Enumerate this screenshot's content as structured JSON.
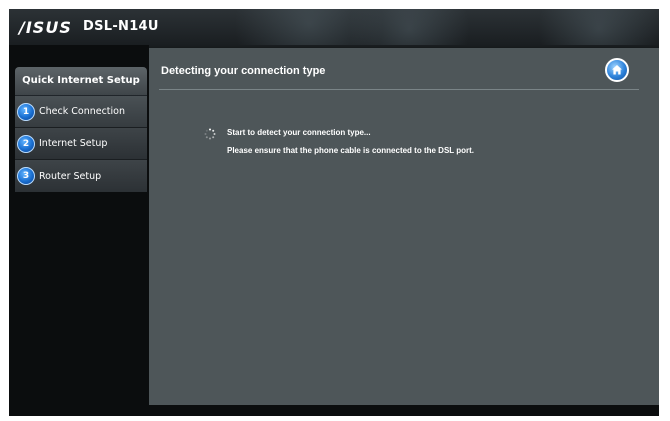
{
  "header": {
    "brand": "/ISUS",
    "model": "DSL-N14U"
  },
  "sidebar": {
    "title": "Quick Internet Setup",
    "steps": [
      {
        "number": "1",
        "label": "Check Connection",
        "active": true
      },
      {
        "number": "2",
        "label": "Internet Setup",
        "active": false
      },
      {
        "number": "3",
        "label": "Router Setup",
        "active": false
      }
    ]
  },
  "main": {
    "title": "Detecting your connection type",
    "home_icon": "home-icon",
    "spinner_icon": "loading-spinner-icon",
    "status_line": "Start to detect your connection type...",
    "instruction_line": "Please ensure that the phone cable is connected to the DSL port."
  },
  "colors": {
    "background": "#0b0d0e",
    "panel": "#4e5659",
    "accent_blue": "#2d82da",
    "text": "#ffffff"
  }
}
